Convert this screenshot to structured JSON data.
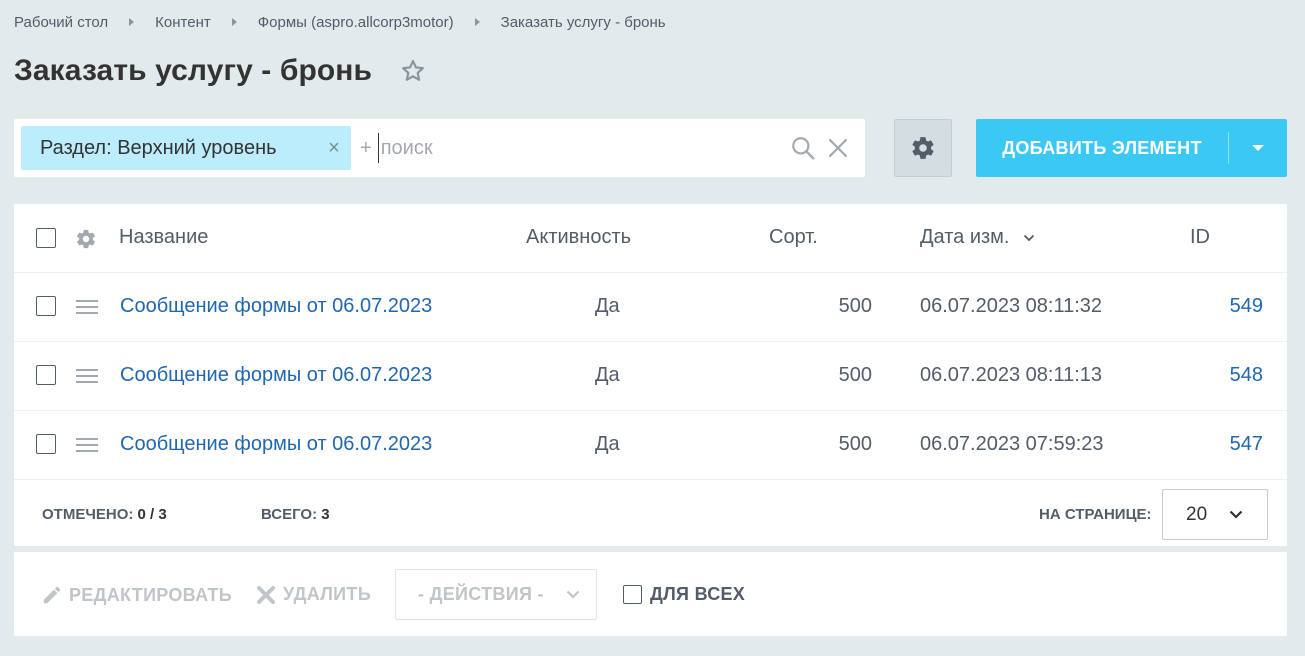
{
  "breadcrumbs": [
    "Рабочий стол",
    "Контент",
    "Формы (aspro.allcorp3motor)",
    "Заказать услугу - бронь"
  ],
  "page_title": "Заказать услугу - бронь",
  "filter": {
    "chip_label": "Раздел: Верхний уровень",
    "chip_close": "×",
    "plus": "+",
    "search_placeholder": "поиск"
  },
  "toolbar": {
    "add_label": "ДОБАВИТЬ ЭЛЕМЕНТ"
  },
  "grid": {
    "columns": {
      "name": "Название",
      "active": "Активность",
      "sort": "Сорт.",
      "date": "Дата изм.",
      "id": "ID"
    },
    "rows": [
      {
        "name": "Сообщение формы от 06.07.2023",
        "active": "Да",
        "sort": "500",
        "date": "06.07.2023 08:11:32",
        "id": "549"
      },
      {
        "name": "Сообщение формы от 06.07.2023",
        "active": "Да",
        "sort": "500",
        "date": "06.07.2023 08:11:13",
        "id": "548"
      },
      {
        "name": "Сообщение формы от 06.07.2023",
        "active": "Да",
        "sort": "500",
        "date": "06.07.2023 07:59:23",
        "id": "547"
      }
    ]
  },
  "footer": {
    "selected_label": "ОТМЕЧЕНО:",
    "selected_value": "0 / 3",
    "total_label": "ВСЕГО:",
    "total_value": "3",
    "per_page_label": "НА СТРАНИЦЕ:",
    "per_page_value": "20"
  },
  "actions": {
    "edit_label": "РЕДАКТИРОВАТЬ",
    "delete_label": "УДАЛИТЬ",
    "actions_select": "- ДЕЙСТВИЯ -",
    "for_all_label": "ДЛЯ ВСЕХ"
  },
  "colors": {
    "accent": "#3bc8f5",
    "link": "#2067b0",
    "chip": "#bcedfc",
    "background": "#e3eaec"
  },
  "icons": [
    "star-icon",
    "search-icon",
    "close-icon",
    "gear-icon",
    "chevron-down-icon",
    "drag-handle-icon",
    "pencil-icon"
  ]
}
